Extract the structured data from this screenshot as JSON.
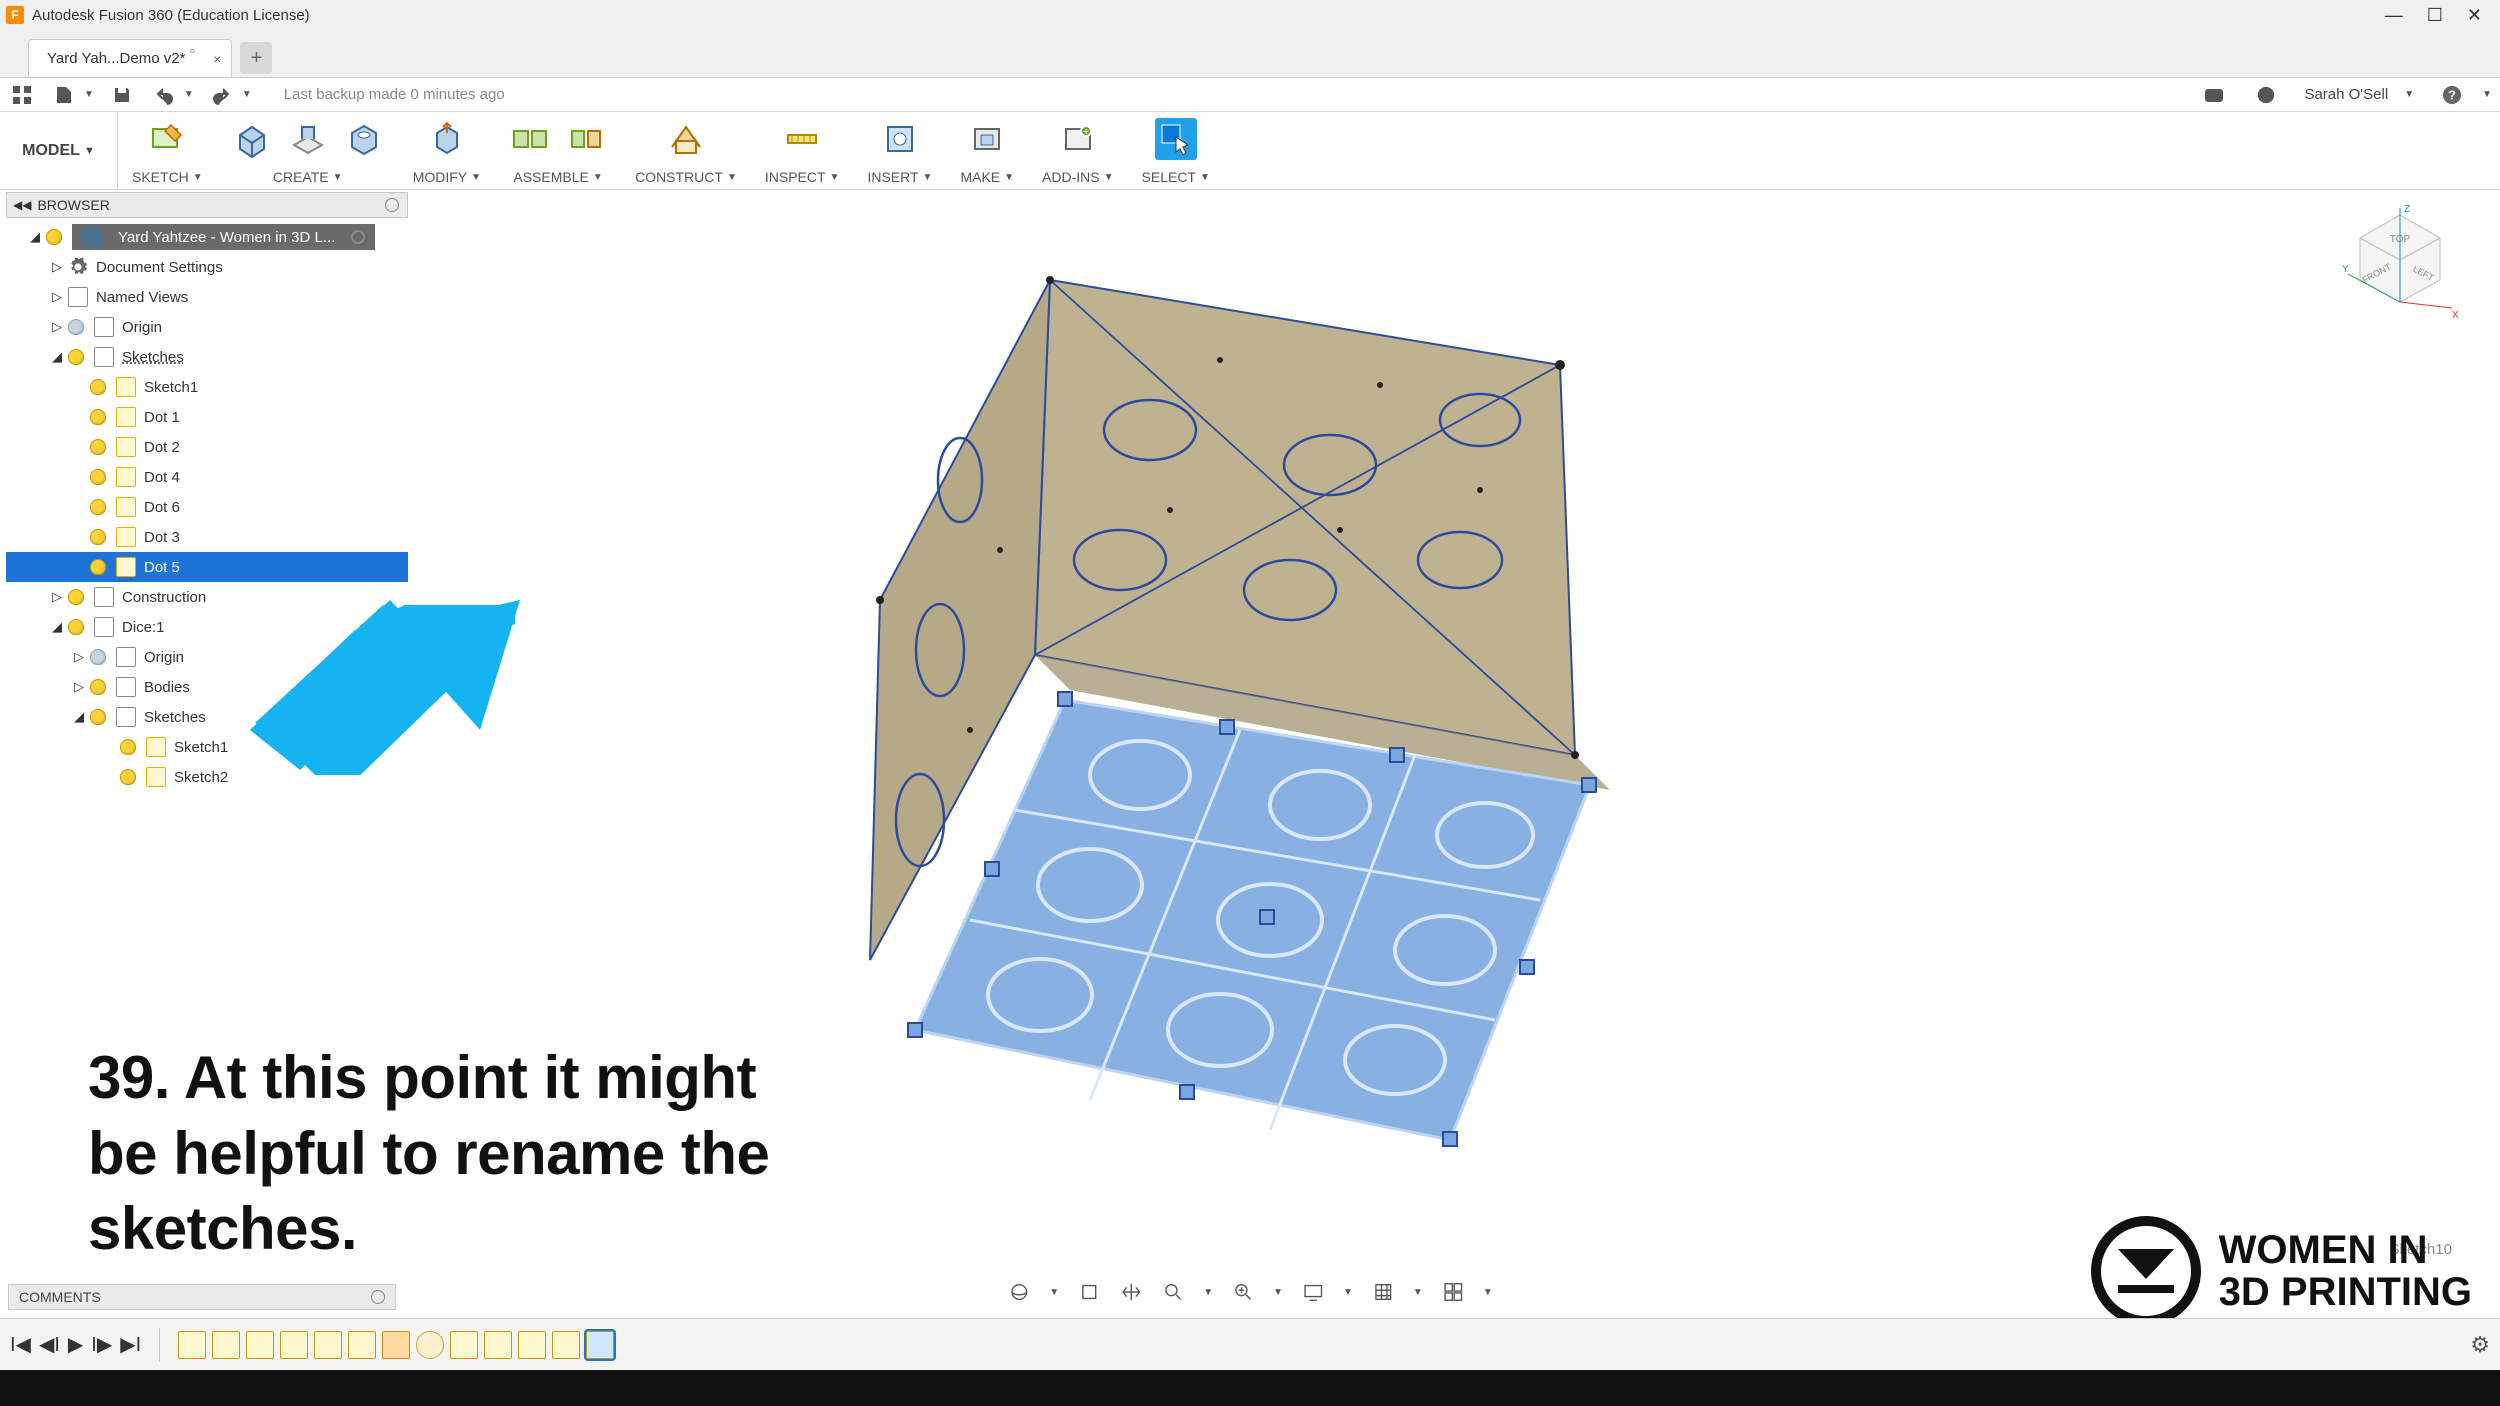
{
  "app": {
    "title": "Autodesk Fusion 360 (Education License)",
    "icon_letter": "F"
  },
  "tabs": {
    "active": "Yard Yah...Demo v2*"
  },
  "quick": {
    "backup": "Last backup made 0 minutes ago",
    "user": "Sarah O'Sell"
  },
  "workspace": {
    "label": "MODEL"
  },
  "ribbon": [
    {
      "label": "SKETCH"
    },
    {
      "label": "CREATE"
    },
    {
      "label": "MODIFY"
    },
    {
      "label": "ASSEMBLE"
    },
    {
      "label": "CONSTRUCT"
    },
    {
      "label": "INSPECT"
    },
    {
      "label": "INSERT"
    },
    {
      "label": "MAKE"
    },
    {
      "label": "ADD-INS"
    },
    {
      "label": "SELECT"
    }
  ],
  "browser": {
    "title": "BROWSER",
    "root": "Yard Yahtzee - Women in 3D L...",
    "doc_settings": "Document Settings",
    "named_views": "Named Views",
    "origin": "Origin",
    "sketches_label": "Sketches",
    "sketches": [
      "Sketch1",
      "Dot 1",
      "Dot 2",
      "Dot 4",
      "Dot 6",
      "Dot 3",
      "Dot 5"
    ],
    "construction": "Construction",
    "dice": "Dice:1",
    "dice_origin": "Origin",
    "dice_bodies": "Bodies",
    "dice_sketches_label": "Sketches",
    "dice_sketches": [
      "Sketch1",
      "Sketch2"
    ]
  },
  "instruction": "39. At this point it might be helpful to rename the sketches.",
  "comments": {
    "label": "COMMENTS"
  },
  "viewcube": {
    "top": "TOP",
    "front": "FRONT",
    "left": "LEFT",
    "x": "X",
    "y": "Y",
    "z": "Z"
  },
  "sketch_label": "Sketch10",
  "logo": {
    "line1": "WOMEN IN",
    "line2": "3D PRINTING"
  },
  "timeline_steps": 13
}
